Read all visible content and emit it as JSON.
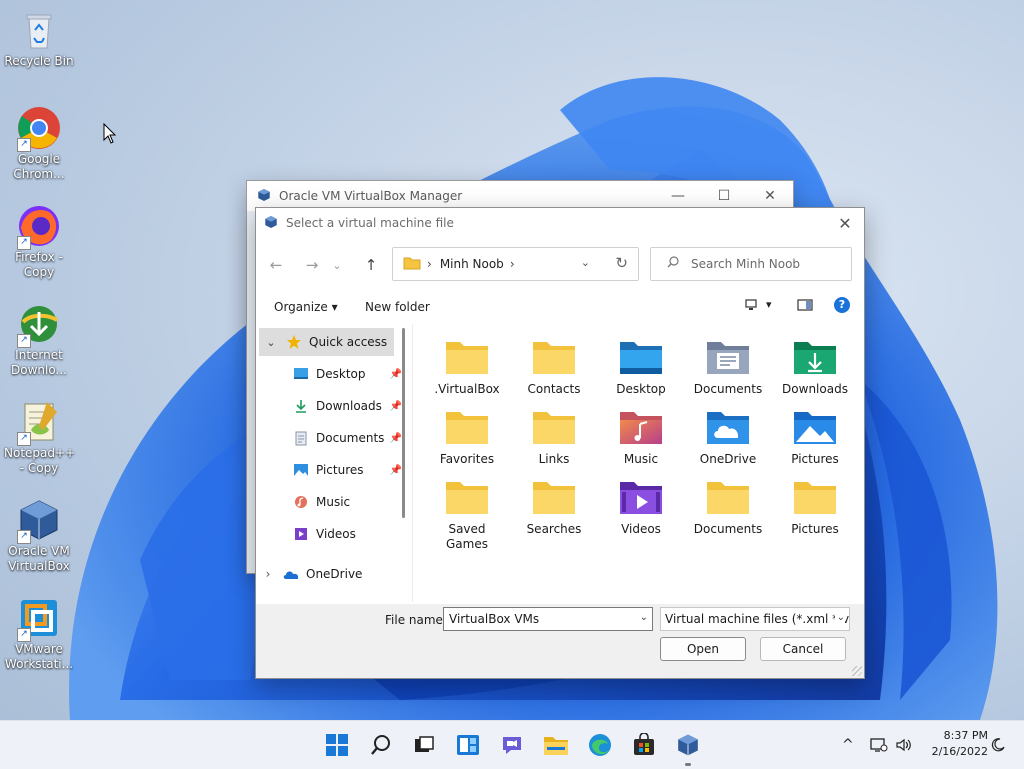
{
  "desktop": {
    "icons": [
      {
        "label": "Recycle Bin",
        "icon": "recycle-bin-icon"
      },
      {
        "label": "Google Chrom...",
        "icon": "chrome-icon"
      },
      {
        "label": "Firefox - Copy",
        "icon": "firefox-icon"
      },
      {
        "label": "Internet Downlo...",
        "icon": "internet-download-manager-icon"
      },
      {
        "label": "Notepad++ - Copy",
        "icon": "notepadpp-icon"
      },
      {
        "label": "Oracle VM VirtualBox",
        "icon": "virtualbox-icon"
      },
      {
        "label": "VMware Workstati...",
        "icon": "vmware-icon"
      }
    ]
  },
  "background_window": {
    "title": "Oracle VM VirtualBox Manager",
    "minimize": "—",
    "maximize": "☐",
    "close": "✕"
  },
  "dialog": {
    "title": "Select a virtual machine file",
    "close": "✕",
    "nav": {
      "back": "←",
      "forward": "→",
      "recent": "⌄",
      "up": "↑"
    },
    "address": {
      "crumb_sep": "›",
      "crumb": "Minh Noob",
      "trail_sep": "›",
      "dropdown": "⌄",
      "refresh": "↻"
    },
    "search_placeholder": "Search Minh Noob",
    "toolbar": {
      "organize": "Organize ▾",
      "new_folder": "New folder",
      "view_arrow": "▾",
      "help": "?"
    },
    "navpane": [
      {
        "label": "Quick access",
        "icon": "star-icon",
        "expander": "⌄",
        "selected": true,
        "pinned": false
      },
      {
        "label": "Desktop",
        "icon": "desktop-folder-icon",
        "pinned": true
      },
      {
        "label": "Downloads",
        "icon": "download-arrow-icon",
        "pinned": true
      },
      {
        "label": "Documents",
        "icon": "documents-icon",
        "pinned": true
      },
      {
        "label": "Pictures",
        "icon": "pictures-icon",
        "pinned": true
      },
      {
        "label": "Music",
        "icon": "music-icon",
        "pinned": false
      },
      {
        "label": "Videos",
        "icon": "videos-icon",
        "pinned": false
      },
      {
        "label": "OneDrive",
        "icon": "onedrive-icon",
        "expander": "›",
        "pinned": false
      }
    ],
    "pin_glyph": "📌",
    "items": [
      {
        "label": ".VirtualBox",
        "kind": "folder"
      },
      {
        "label": "Contacts",
        "kind": "folder"
      },
      {
        "label": "Desktop",
        "kind": "desktop"
      },
      {
        "label": "Documents",
        "kind": "documents"
      },
      {
        "label": "Downloads",
        "kind": "downloads"
      },
      {
        "label": "Favorites",
        "kind": "folder"
      },
      {
        "label": "Links",
        "kind": "folder"
      },
      {
        "label": "Music",
        "kind": "music"
      },
      {
        "label": "OneDrive",
        "kind": "onedrive"
      },
      {
        "label": "Pictures",
        "kind": "pictures"
      },
      {
        "label": "Saved Games",
        "kind": "folder"
      },
      {
        "label": "Searches",
        "kind": "folder"
      },
      {
        "label": "Videos",
        "kind": "videos"
      },
      {
        "label": "Documents",
        "kind": "folder"
      },
      {
        "label": "Pictures",
        "kind": "folder"
      }
    ],
    "file_name_label": "File name:",
    "file_name_value": "VirtualBox VMs",
    "file_type_value": "Virtual machine files (*.xml *.vb",
    "open_label": "Open",
    "cancel_label": "Cancel",
    "dropdown_arrow": "⌄"
  },
  "taskbar": {
    "items": [
      "start-icon",
      "search-icon",
      "task-view-icon",
      "widgets-icon",
      "chat-icon",
      "file-explorer-icon",
      "edge-icon",
      "store-icon",
      "virtualbox-icon"
    ],
    "tray": {
      "chevron": "^",
      "time": "8:37 PM",
      "date": "2/16/2022"
    }
  }
}
